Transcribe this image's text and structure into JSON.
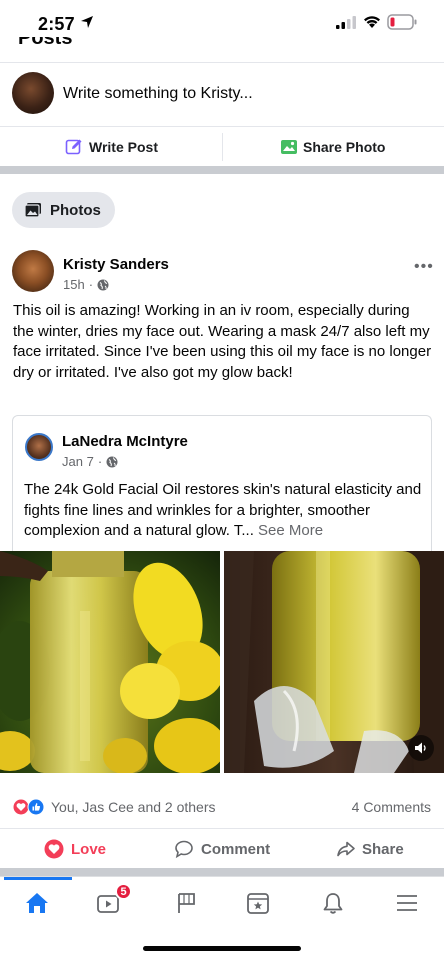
{
  "status_bar": {
    "time": "2:57"
  },
  "profile_section": {
    "heading_partial": "Posts"
  },
  "composer": {
    "placeholder": "Write something to Kristy..."
  },
  "composer_actions": {
    "write_post": "Write Post",
    "share_photo": "Share Photo"
  },
  "photos_chip": {
    "label": "Photos"
  },
  "post": {
    "author": "Kristy Sanders",
    "time": "15h",
    "body": "This oil is amazing! Working in an iv room, especially during the winter, dries my face out. Wearing a mask 24/7 also left my face irritated. Since I've been using this oil my face is no longer dry or irritated. I've also got my glow back!",
    "shared": {
      "author": "LaNedra McIntyre",
      "time": "Jan 7",
      "body": "The 24k Gold Facial Oil restores skin's natural elasticity and fights fine lines and wrinkles for a brighter, smoother complexion and a natural glow. T...",
      "see_more": "See More"
    },
    "reactions": {
      "summary": "You, Jas Cee and 2 others",
      "comments": "4 Comments"
    },
    "actions": {
      "love": "Love",
      "comment": "Comment",
      "share": "Share"
    }
  },
  "tabbar": {
    "video_badge": "5"
  },
  "colors": {
    "accent": "#1877f2",
    "love": "#f33e58",
    "badge": "#e41e3f",
    "share_photo_green": "#45bd62"
  }
}
